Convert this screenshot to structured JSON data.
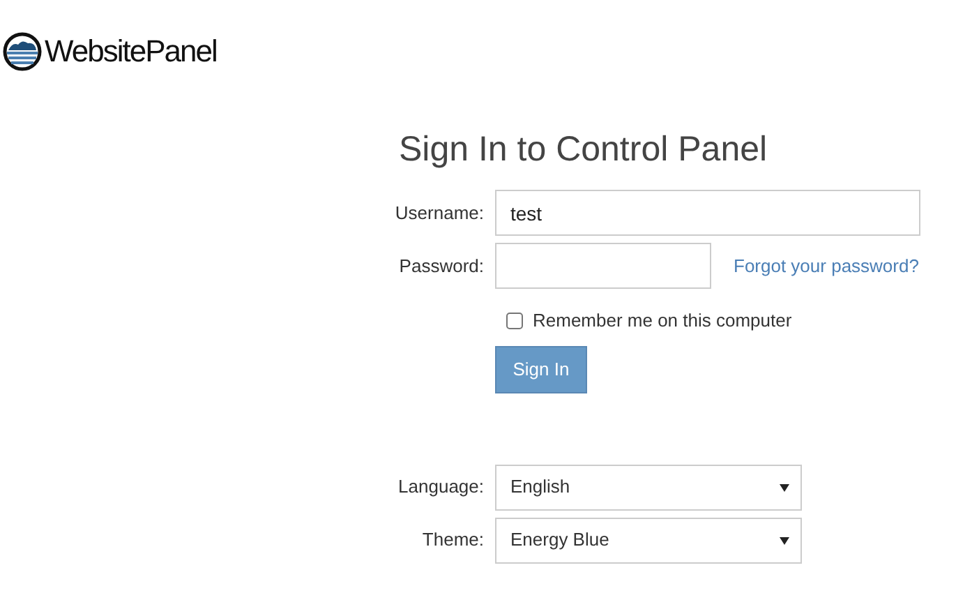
{
  "logo": {
    "text": "WebsitePanel"
  },
  "title": "Sign In to Control Panel",
  "username": {
    "label": "Username:",
    "value": "test"
  },
  "password": {
    "label": "Password:"
  },
  "forgot_link": "Forgot your password?",
  "remember": {
    "label": "Remember me on this computer",
    "checked": false
  },
  "sign_in_button": "Sign In",
  "language": {
    "label": "Language:",
    "value": "English"
  },
  "theme": {
    "label": "Theme:",
    "value": "Energy Blue"
  }
}
